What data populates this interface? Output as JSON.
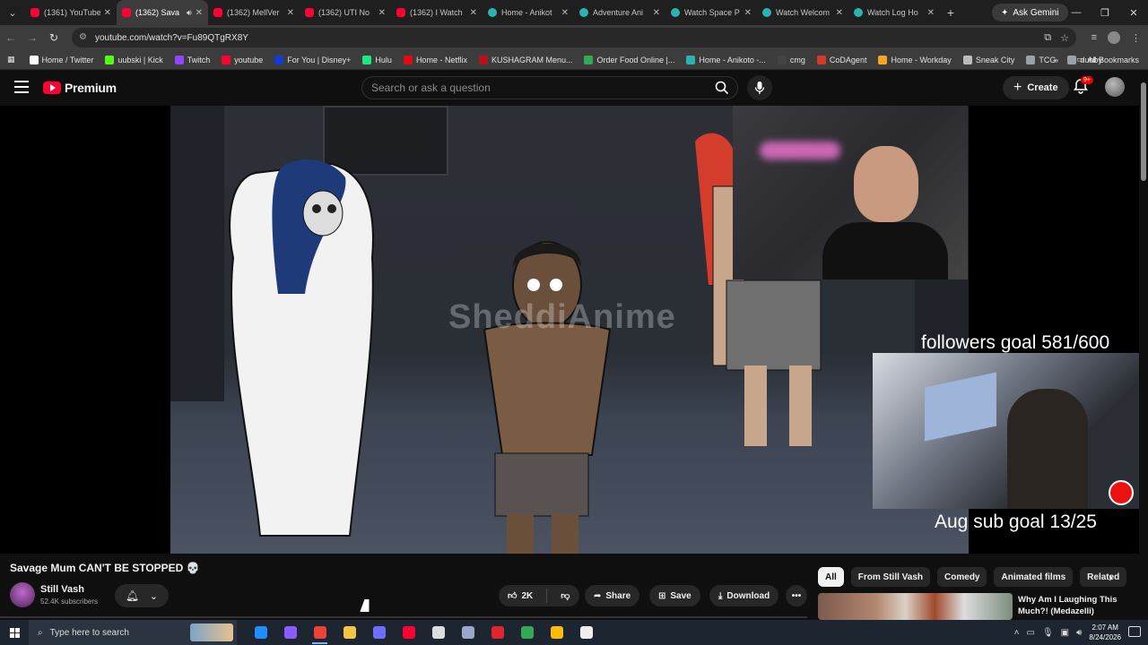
{
  "browser": {
    "tabs": [
      {
        "label": "(1361) YouTube",
        "type": "yt",
        "active": false
      },
      {
        "label": "(1362) Sava",
        "type": "yt",
        "active": true
      },
      {
        "label": "(1362) MellVer",
        "type": "yt",
        "active": false
      },
      {
        "label": "(1362) UTI No",
        "type": "yt",
        "active": false
      },
      {
        "label": "(1362) I Watch",
        "type": "yt",
        "active": false
      },
      {
        "label": "Home - Anikot",
        "type": "anim",
        "active": false
      },
      {
        "label": "Adventure Ani",
        "type": "anim",
        "active": false
      },
      {
        "label": "Watch Space P",
        "type": "anim",
        "active": false
      },
      {
        "label": "Watch Welcom",
        "type": "anim",
        "active": false
      },
      {
        "label": "Watch Log Ho",
        "type": "anim",
        "active": false
      }
    ],
    "ask_gemini": "Ask Gemini",
    "url": "youtube.com/watch?v=Fu89QTgRX8Y",
    "bookmarks": [
      {
        "label": "Home / Twitter",
        "color": "#ffffff"
      },
      {
        "label": "uubski | Kick",
        "color": "#53fc18"
      },
      {
        "label": "Twitch",
        "color": "#9146ff"
      },
      {
        "label": "youtube",
        "color": "#ff0033"
      },
      {
        "label": "For You | Disney+",
        "color": "#113ccf"
      },
      {
        "label": "Hulu",
        "color": "#1ce783"
      },
      {
        "label": "Home - Netflix",
        "color": "#e50914"
      },
      {
        "label": "KUSHAGRAM Menu...",
        "color": "#b5121b"
      },
      {
        "label": "Order Food Online |...",
        "color": "#34a853"
      },
      {
        "label": "Home - Anikoto -...",
        "color": "#2bb3b1"
      },
      {
        "label": "cmg",
        "color": "#444444"
      },
      {
        "label": "CoDAgent",
        "color": "#d33a2c"
      },
      {
        "label": "Home - Workday",
        "color": "#f5a623"
      },
      {
        "label": "Sneak City",
        "color": "#bbbbbb"
      },
      {
        "label": "TCG",
        "color": "#9aa0a6"
      },
      {
        "label": "dubby",
        "color": "#9aa0a6"
      }
    ],
    "all_bookmarks": "All Bookmarks"
  },
  "youtube": {
    "logo_text": "Premium",
    "search_placeholder": "Search or ask a question",
    "create_label": "Create",
    "notification_badge": "9+",
    "video": {
      "watermark": "SheddiAnime",
      "followers_goal": "followers goal 581/600",
      "sub_goal": "Aug sub goal 13/25"
    },
    "title": "Savage Mum CAN'T BE STOPPED 💀",
    "channel": {
      "name": "Still Vash",
      "subscribers": "52.4K subscribers"
    },
    "actions": {
      "likes": "2K",
      "share": "Share",
      "save": "Save",
      "download": "Download"
    },
    "chips": [
      "All",
      "From Still Vash",
      "Comedy",
      "Animated films",
      "Related"
    ],
    "recommendation": {
      "title": "Why Am I Laughing This Much?! (Medazelli)"
    }
  },
  "taskbar": {
    "search_placeholder": "Type here to search",
    "time": "2:07 AM",
    "date": "8/24/2026",
    "apps": [
      {
        "name": "edge-app",
        "color": "#1f8fff"
      },
      {
        "name": "chrome-profile-app",
        "color": "#8a5cff"
      },
      {
        "name": "chrome-app",
        "color": "#ea4335"
      },
      {
        "name": "file-explorer-app",
        "color": "#f4c542"
      },
      {
        "name": "game-app",
        "color": "#6d6dff"
      },
      {
        "name": "youtube-app",
        "color": "#ff0033"
      },
      {
        "name": "obs-app",
        "color": "#dddddd"
      },
      {
        "name": "steam-app",
        "color": "#9ba7c9"
      },
      {
        "name": "acrobat-app",
        "color": "#e0262c"
      },
      {
        "name": "chrome-app-2",
        "color": "#34a853"
      },
      {
        "name": "chrome-app-3",
        "color": "#fbbc05"
      },
      {
        "name": "clock-app",
        "color": "#eeeeee"
      }
    ]
  }
}
